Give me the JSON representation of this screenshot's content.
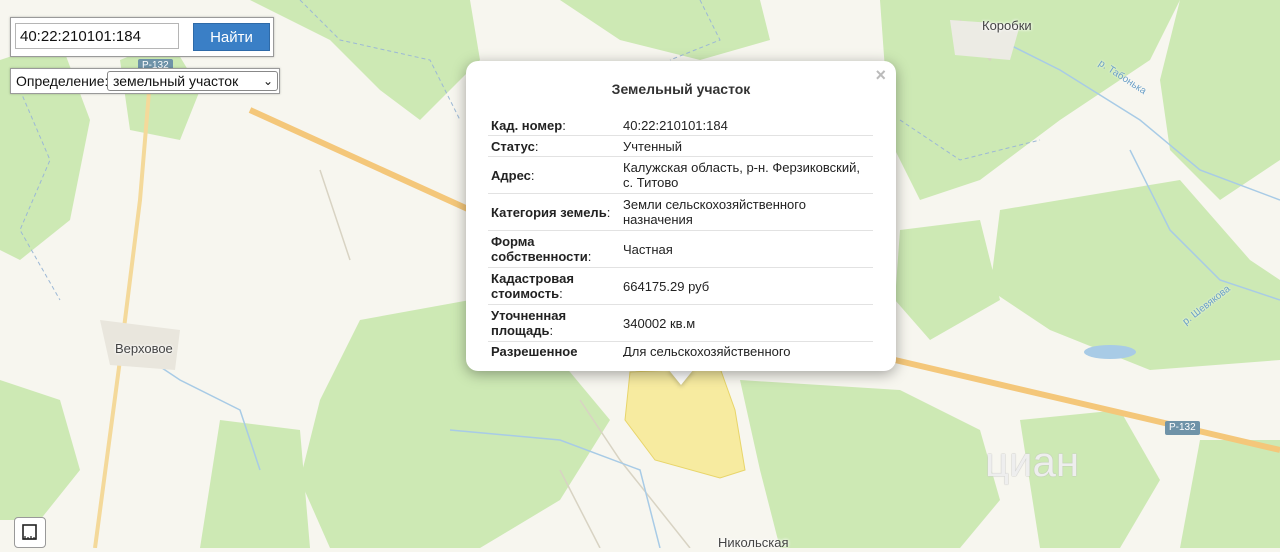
{
  "search": {
    "value": "40:22:210101:184",
    "button_label": "Найти"
  },
  "definition": {
    "label": "Определение:",
    "selected": "земельный участок"
  },
  "map": {
    "places": [
      "Коробки",
      "Верховое",
      "Никольская"
    ],
    "rivers": [
      "р. Табонька",
      "р. Шевякова"
    ],
    "roads": [
      "Р-132",
      "Р-132"
    ],
    "watermark": "циан"
  },
  "popup": {
    "title": "Земельный участок",
    "close": "×",
    "rows": [
      {
        "key": "Кад. номер",
        "value": "40:22:210101:184"
      },
      {
        "key": "Статус",
        "value": "Учтенный"
      },
      {
        "key": "Адрес",
        "value": "Калужская область, р-н. Ферзиковский, с. Титово"
      },
      {
        "key": "Категория земель",
        "value": "Земли сельскохозяйственного назначения"
      },
      {
        "key": "Форма собственности",
        "value": "Частная"
      },
      {
        "key": "Кадастровая стоимость",
        "value": "664175.29 руб"
      },
      {
        "key": "Уточненная площадь",
        "value": "340002 кв.м"
      },
      {
        "key": "Разрешенное",
        "value": "Для сельскохозяйственного"
      }
    ]
  },
  "colors": {
    "forest": "#cde9b4",
    "road": "#f4c77a",
    "parcel": "#f7eba0",
    "water": "#a8cbe6",
    "button": "#3a7fc6"
  }
}
